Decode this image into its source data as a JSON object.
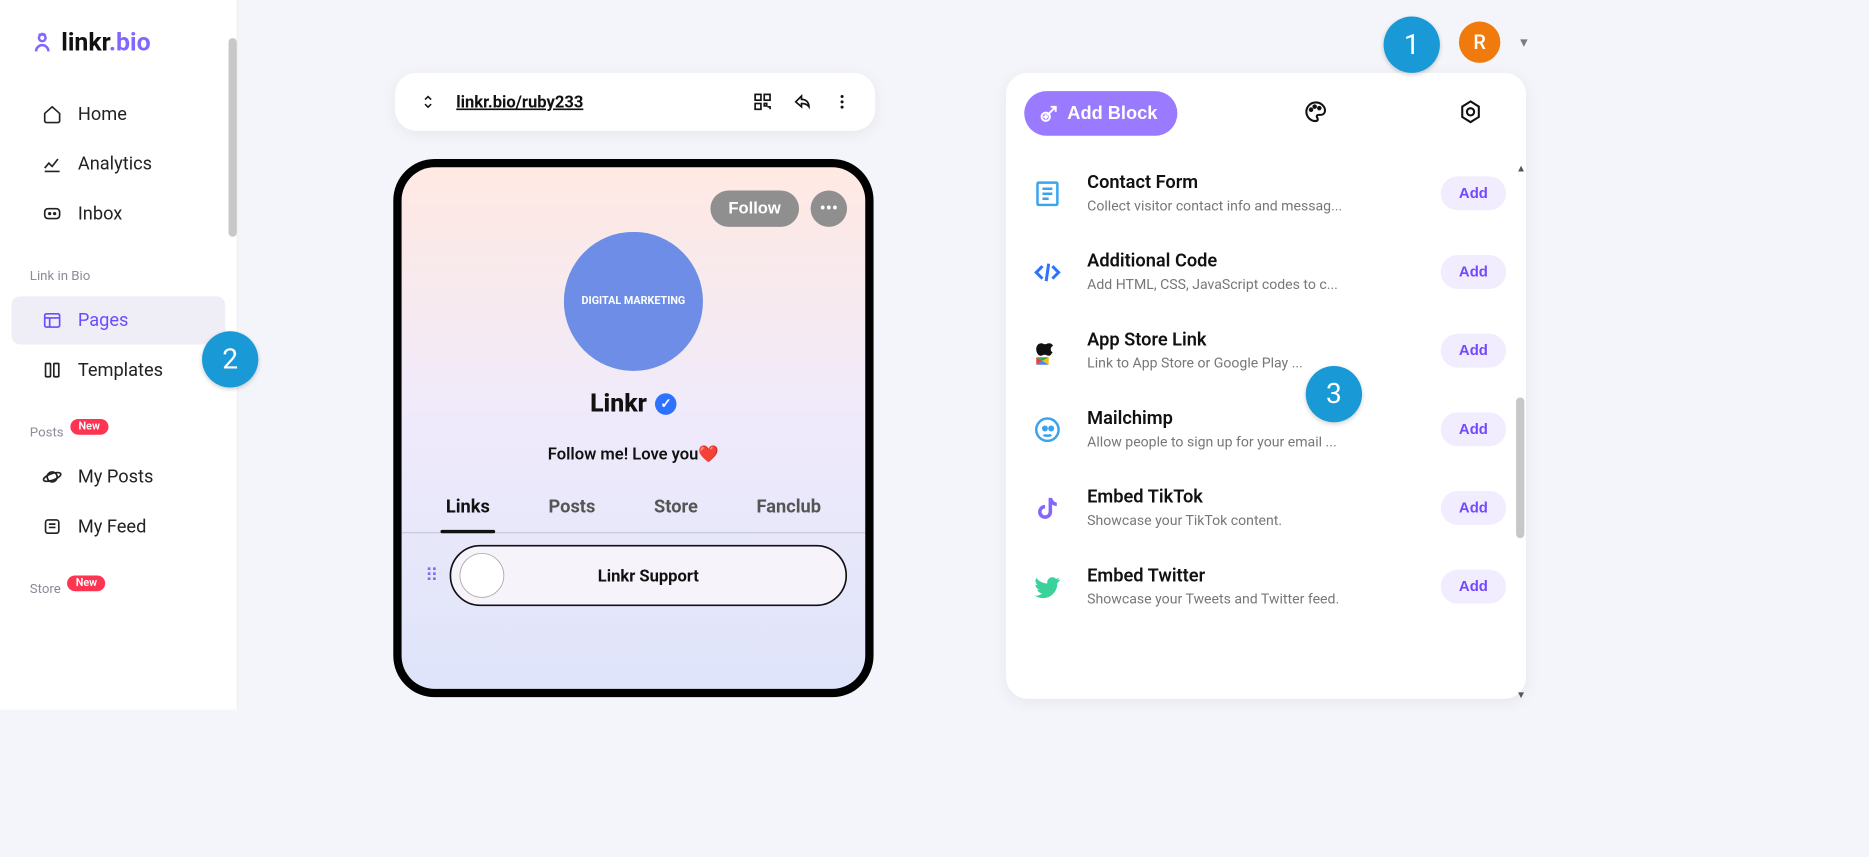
{
  "logo": {
    "brand_prefix": "linkr",
    "brand_suffix": ".bio"
  },
  "topbar": {
    "avatar_initial": "R"
  },
  "callouts": {
    "one": "1",
    "two": "2",
    "three": "3"
  },
  "sidebar": {
    "nav_main": [
      {
        "label": "Home"
      },
      {
        "label": "Analytics"
      },
      {
        "label": "Inbox"
      }
    ],
    "section_linkinbio": "Link in Bio",
    "nav_bio": [
      {
        "label": "Pages"
      },
      {
        "label": "Templates"
      }
    ],
    "section_posts": "Posts",
    "badge_posts": "New",
    "nav_posts": [
      {
        "label": "My Posts"
      },
      {
        "label": "My Feed"
      }
    ],
    "section_store": "Store",
    "badge_store": "New"
  },
  "urlbar": {
    "url": "linkr.bio/ruby233"
  },
  "preview": {
    "follow": "Follow",
    "avatar_text": "DIGITAL MARKETING",
    "name": "Linkr",
    "bio": "Follow me! Love you❤️",
    "tabs": [
      "Links",
      "Posts",
      "Store",
      "Fanclub"
    ],
    "link_title": "Linkr Support"
  },
  "panel": {
    "add_block": "Add Block",
    "add_label": "Add",
    "blocks": [
      {
        "title": "Contact Form",
        "desc": "Collect visitor contact info and messag..."
      },
      {
        "title": "Additional Code",
        "desc": "Add HTML, CSS, JavaScript codes to c..."
      },
      {
        "title": "App Store Link",
        "desc": "Link to App Store or Google Play ..."
      },
      {
        "title": "Mailchimp",
        "desc": "Allow people to sign up for your email ..."
      },
      {
        "title": "Embed TikTok",
        "desc": "Showcase your TikTok content."
      },
      {
        "title": "Embed Twitter",
        "desc": "Showcase your Tweets and Twitter feed."
      }
    ]
  }
}
